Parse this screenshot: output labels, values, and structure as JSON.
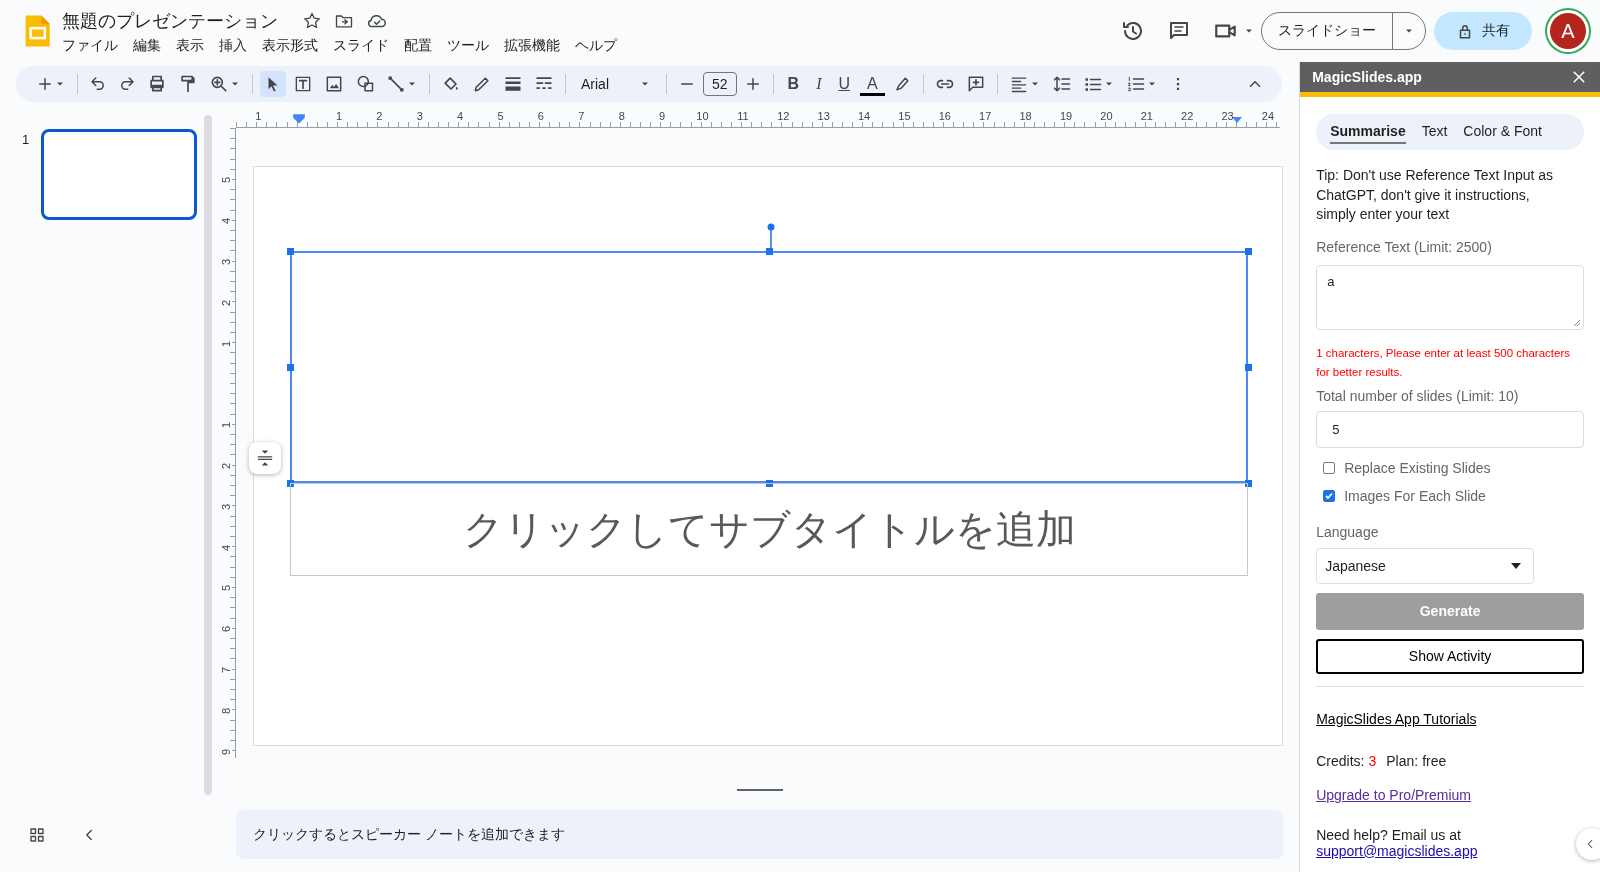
{
  "header": {
    "title": "無題のプレゼンテーション",
    "menu": [
      "ファイル",
      "編集",
      "表示",
      "挿入",
      "表示形式",
      "スライド",
      "配置",
      "ツール",
      "拡張機能",
      "ヘルプ"
    ],
    "slideshow_button": "スライドショー",
    "share_button": "共有",
    "avatar": "A"
  },
  "toolbar": {
    "pointer_selected": true,
    "font": "Arial",
    "font_size": "52",
    "format_buttons": [
      "B",
      "I",
      "U",
      "A"
    ]
  },
  "filmstrip": {
    "slides": [
      {
        "number": "1",
        "selected": true
      }
    ]
  },
  "rulers": {
    "horizontal_before": [
      "1"
    ],
    "horizontal_after": [
      "1",
      "2",
      "3",
      "4",
      "5",
      "6",
      "7",
      "8",
      "9",
      "10",
      "11",
      "12",
      "13",
      "14",
      "15",
      "16",
      "17",
      "18",
      "19",
      "20",
      "21",
      "22",
      "23",
      "24"
    ],
    "vertical_above": [
      "5",
      "4",
      "3",
      "2",
      "1"
    ],
    "vertical_below": [
      "1",
      "2",
      "3",
      "4",
      "5",
      "6",
      "7",
      "8",
      "9"
    ]
  },
  "slide": {
    "title_box": {
      "selected": true
    },
    "subtitle_placeholder": "クリックしてサブタイトルを追加"
  },
  "notes": {
    "placeholder": "クリックするとスピーカー ノートを追加できます"
  },
  "panel": {
    "title": "MagicSlides.app",
    "tabs": [
      {
        "label": "Summarise",
        "selected": true
      },
      {
        "label": "Text",
        "selected": false
      },
      {
        "label": "Color & Font",
        "selected": false
      }
    ],
    "tip": "Tip: Don't use Reference Text Input as ChatGPT, don't give it instructions, simply enter your text",
    "reference_label": "Reference Text (Limit: 2500)",
    "reference_value": "a",
    "error": "1 characters, Please enter at least 500 characters for better results.",
    "slides_label": "Total number of slides (Limit: 10)",
    "slides_value": "5",
    "checkboxes": [
      {
        "label": "Replace Existing Slides",
        "checked": false
      },
      {
        "label": "Images For Each Slide",
        "checked": true
      }
    ],
    "language_label": "Language",
    "language_value": "Japanese",
    "generate_button": {
      "label": "Generate",
      "disabled": true
    },
    "activity_button": "Show Activity",
    "tutorials_link": "MagicSlides App Tutorials",
    "credits_label": "Credits:",
    "credits_value": "3",
    "plan_label": "Plan:",
    "plan_value": "free",
    "upgrade_link": "Upgrade to Pro/Premium",
    "help_text": "Need help? Email us at",
    "email_link": "support@magicslides.app"
  }
}
